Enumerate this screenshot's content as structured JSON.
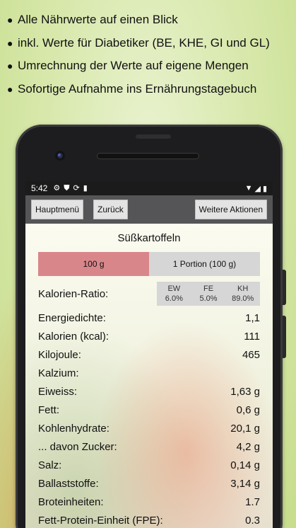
{
  "promo": {
    "bullets": [
      "Alle Nährwerte auf einen Blick",
      "inkl. Werte für Diabetiker (BE, KHE, GI und GL)",
      "Umrechnung der Werte auf eigene Mengen",
      "Sofortige Aufnahme ins Ernährungstagebuch"
    ]
  },
  "status_bar": {
    "time": "5:42"
  },
  "toolbar": {
    "main_menu": "Hauptmenü",
    "back": "Zurück",
    "more_actions": "Weitere Aktionen"
  },
  "food": {
    "title": "Süßkartoffeln",
    "tabs": [
      {
        "label": "100 g",
        "active": true
      },
      {
        "label": "1 Portion (100 g)",
        "active": false
      }
    ],
    "calorie_ratio": {
      "label": "Kalorien-Ratio:",
      "columns": [
        {
          "name": "EW",
          "value": "6.0%"
        },
        {
          "name": "FE",
          "value": "5.0%"
        },
        {
          "name": "KH",
          "value": "89.0%"
        }
      ]
    },
    "nutrients": [
      {
        "label": "Energiedichte:",
        "value": "1,1"
      },
      {
        "label": "Kalorien (kcal):",
        "value": "111"
      },
      {
        "label": "Kilojoule:",
        "value": "465"
      },
      {
        "label": "Kalzium:",
        "value": ""
      },
      {
        "label": "Eiweiss:",
        "value": "1,63 g"
      },
      {
        "label": "Fett:",
        "value": "0,6 g"
      },
      {
        "label": "Kohlenhydrate:",
        "value": "20,1 g"
      },
      {
        "label": "... davon Zucker:",
        "value": "4,2 g"
      },
      {
        "label": "Salz:",
        "value": "0,14 g"
      },
      {
        "label": "Ballaststoffe:",
        "value": "3,14 g"
      },
      {
        "label": "Broteinheiten:",
        "value": "1.7"
      },
      {
        "label": "Fett-Protein-Einheit (FPE):",
        "value": "0.3"
      }
    ]
  }
}
